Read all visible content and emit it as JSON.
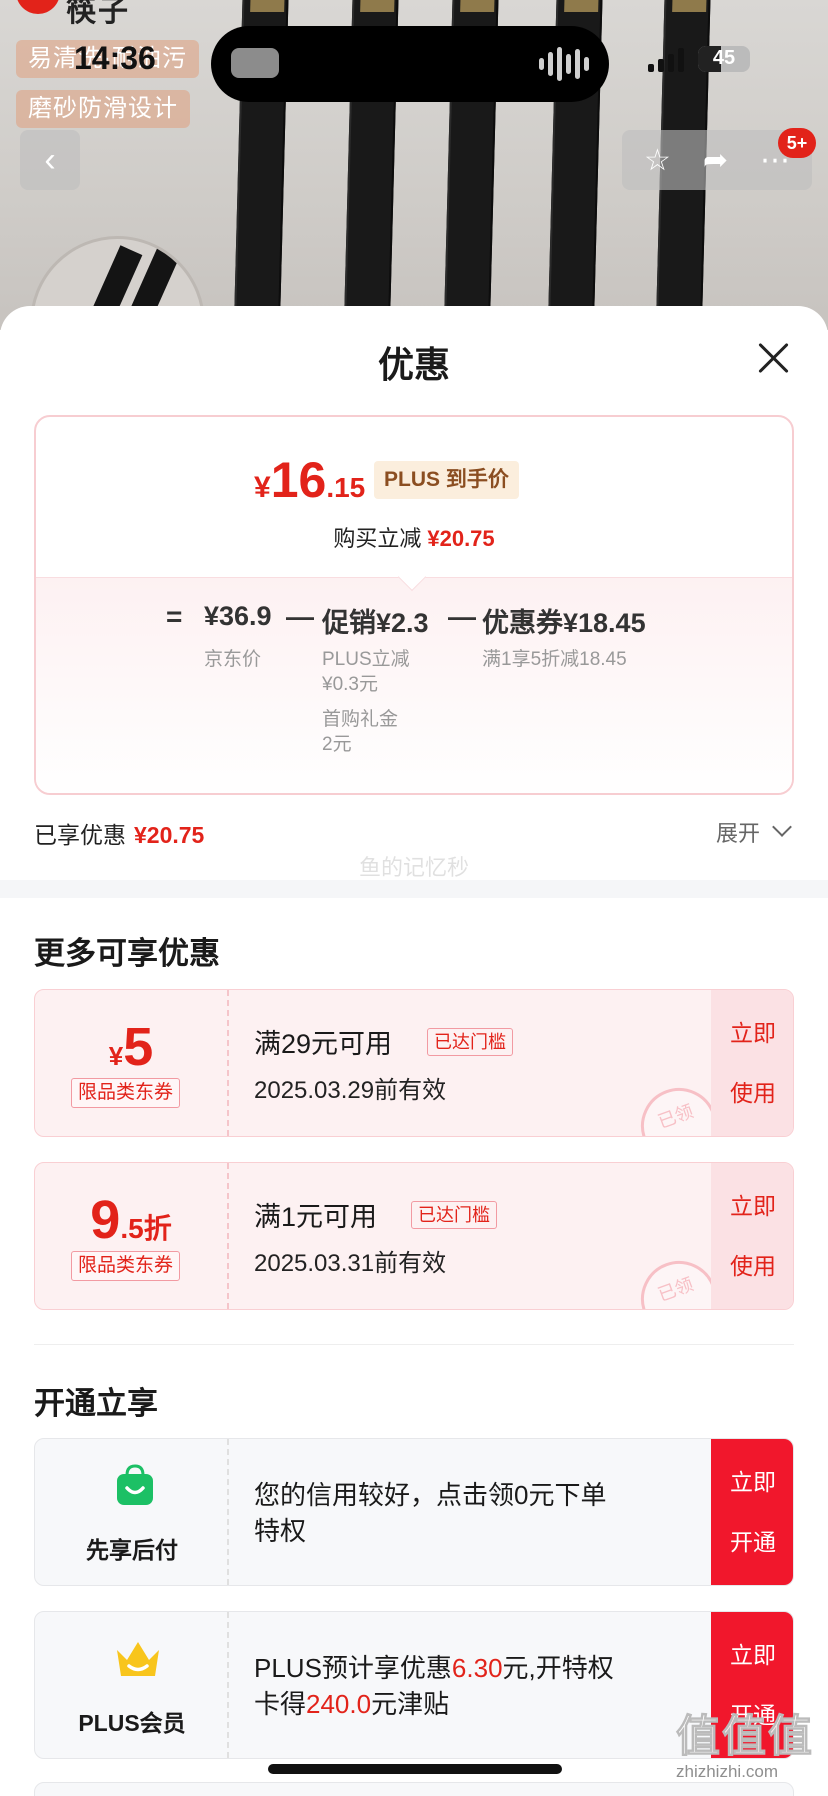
{
  "status_bar": {
    "time": "14:36",
    "battery": "45",
    "battery_level": 0.45
  },
  "background": {
    "brand_fragment": "筷子",
    "tags": [
      "易清洗·耐油污",
      "磨砂防滑设计"
    ],
    "notification_badge": "5+"
  },
  "sheet": {
    "title": "优惠"
  },
  "price_card": {
    "currency": "¥",
    "price_int": "16",
    "price_dec": ".15",
    "plus_label": "PLUS 到手价",
    "reduce_label": "购买立减",
    "reduce_amount": "¥20.75",
    "formula": {
      "eq": "=",
      "minus": "—",
      "jd_price": "¥36.9",
      "jd_price_label": "京东价",
      "promo": "促销¥2.3",
      "promo_detail_1": "PLUS立减",
      "promo_detail_1b": "¥0.3元",
      "promo_detail_2": "首购礼金",
      "promo_detail_2b": "2元",
      "coupon": "优惠券¥18.45",
      "coupon_detail": "满1享5折减18.45"
    }
  },
  "enjoyed": {
    "label": "已享优惠",
    "amount": "¥20.75",
    "expand_label": "展开"
  },
  "watermark": "鱼的记忆秒",
  "more_section": {
    "title": "更多可享优惠",
    "coupons": [
      {
        "symbol": "¥",
        "value": "5",
        "suffix": "",
        "type": "限品类东券",
        "condition": "满29元可用",
        "reached": "已达门槛",
        "valid": "2025.03.29前有效",
        "use_1": "立即",
        "use_2": "使用",
        "stamp": "已领"
      },
      {
        "symbol": "",
        "value": "9",
        "suffix": ".5折",
        "type": "限品类东券",
        "condition": "满1元可用",
        "reached": "已达门槛",
        "valid": "2025.03.31前有效",
        "use_1": "立即",
        "use_2": "使用",
        "stamp": "已领"
      }
    ]
  },
  "open_section": {
    "title": "开通立享",
    "items": [
      {
        "name": "先享后付",
        "desc_1": "您的信用较好，点击领0元下单",
        "desc_2": "特权",
        "open_1": "立即",
        "open_2": "开通"
      },
      {
        "name": "PLUS会员",
        "desc_a": "PLUS预计享优惠",
        "desc_b": "6.30",
        "desc_c": "元,开特权",
        "desc_d": "卡得",
        "desc_e": "240.0",
        "desc_f": "元津贴",
        "open_1": "立即",
        "open_2": "开通"
      }
    ]
  },
  "corner_watermark": {
    "logo": "值值值",
    "url": "zhizhizhi.com"
  },
  "colors": {
    "accent": "#e2231a",
    "open_button": "#f1172c",
    "coupon_bg": "#fdf1f2",
    "plus_label_bg": "#fbeedd"
  }
}
